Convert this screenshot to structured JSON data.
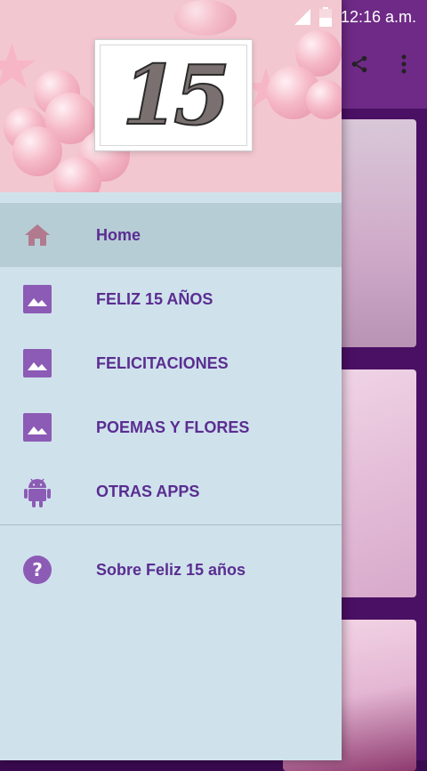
{
  "status_bar": {
    "time": "12:16 a.m."
  },
  "header": {
    "badge_text": "15"
  },
  "menu": {
    "items": [
      {
        "label": "Home",
        "icon": "home-icon",
        "active": true
      },
      {
        "label": "FELIZ 15 AÑOS",
        "icon": "image-icon"
      },
      {
        "label": "FELICITACIONES",
        "icon": "image-icon"
      },
      {
        "label": "POEMAS Y FLORES",
        "icon": "image-icon"
      },
      {
        "label": "OTRAS APPS",
        "icon": "android-icon"
      }
    ],
    "about": {
      "label": "Sobre Feliz 15 años",
      "icon": "help-icon"
    }
  },
  "colors": {
    "accent": "#5a2d91",
    "icon_purple": "#8c5bb5",
    "home_icon": "#b27a8e",
    "drawer_bg": "#cfe2ec",
    "active_bg": "#b6cdd5"
  }
}
